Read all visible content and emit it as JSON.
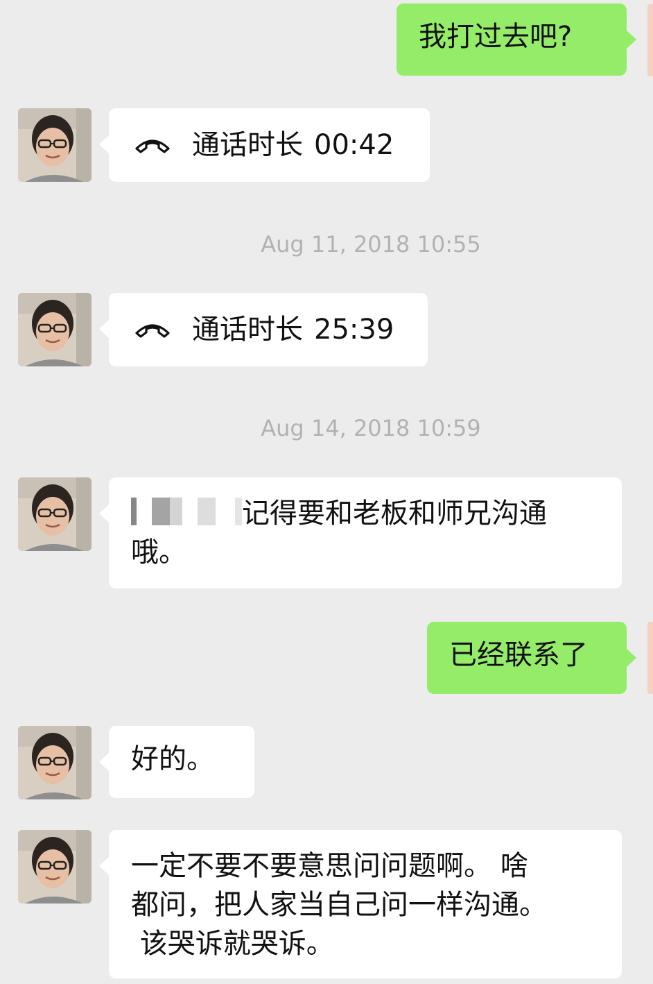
{
  "messages": [
    {
      "side": "right",
      "text": "我打过去吧?"
    },
    {
      "side": "left",
      "call_label": "通话时长",
      "duration": "00:42"
    },
    {
      "side": "center",
      "timestamp": "Aug 11, 2018 10:55"
    },
    {
      "side": "left",
      "call_label": "通话时长",
      "duration": "25:39"
    },
    {
      "side": "center",
      "timestamp": "Aug 14, 2018 10:59"
    },
    {
      "side": "left",
      "text_line1": "记得要和老板和师兄沟通",
      "text_line2": "哦。"
    },
    {
      "side": "right",
      "text": "已经联系了"
    },
    {
      "side": "left",
      "text": "好的。"
    },
    {
      "side": "left",
      "text_line1": "一定不要不要意思问问题啊。 啥",
      "text_line2": "都问，把人家当自己问一样沟通。",
      "text_line3": " 该哭诉就哭诉。"
    }
  ],
  "colors": {
    "background": "#ececec",
    "outgoing_bubble": "#95ec69",
    "incoming_bubble": "#ffffff",
    "timestamp_text": "#b2b2b2"
  },
  "icons": {
    "avatar": "contact-avatar-photo",
    "call": "phone-hangup-icon"
  }
}
